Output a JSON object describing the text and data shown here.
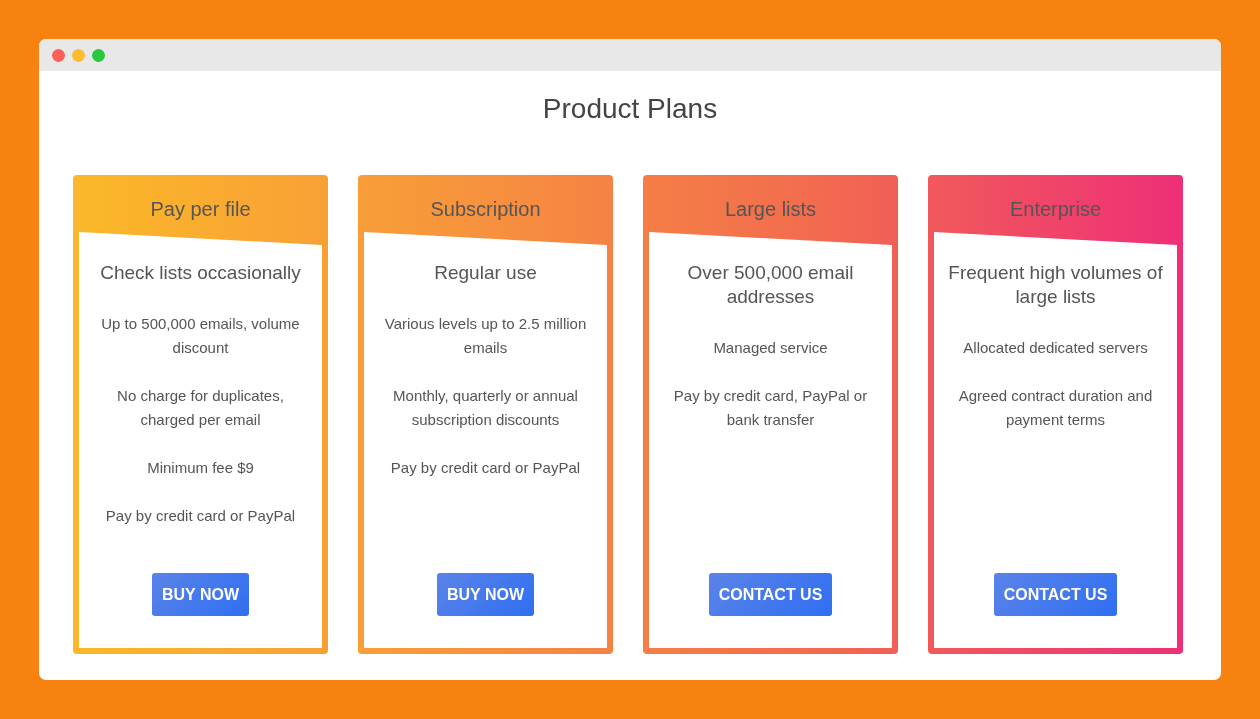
{
  "title": "Product Plans",
  "plans": [
    {
      "name": "Pay per file",
      "tagline": "Check lists occasionally",
      "features": [
        "Up to 500,000 emails, volume discount",
        "No charge for duplicates, charged per email",
        "Minimum fee $9",
        "Pay by credit card or PayPal"
      ],
      "button": "BUY NOW"
    },
    {
      "name": "Subscription",
      "tagline": "Regular use",
      "features": [
        "Various levels up to 2.5 million emails",
        "Monthly, quarterly or annual subscription discounts",
        "Pay by credit card or PayPal"
      ],
      "button": "BUY NOW"
    },
    {
      "name": "Large lists",
      "tagline": "Over 500,000 email addresses",
      "features": [
        "Managed service",
        "Pay by credit card, PayPal or bank transfer"
      ],
      "button": "CONTACT US"
    },
    {
      "name": "Enterprise",
      "tagline": "Frequent high volumes of large lists",
      "features": [
        "Allocated dedicated servers",
        "Agreed contract duration and payment terms"
      ],
      "button": "CONTACT US"
    }
  ]
}
